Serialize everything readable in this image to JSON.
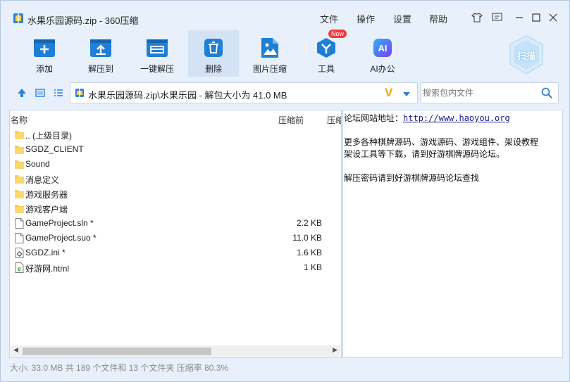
{
  "window": {
    "title": "水果乐园源码.zip - 360压缩"
  },
  "menu": {
    "file": "文件",
    "operate": "操作",
    "settings": "设置",
    "help": "帮助"
  },
  "toolbar": {
    "add": "添加",
    "extract_to": "解压到",
    "one_click_extract": "一键解压",
    "delete": "删除",
    "image_compress": "图片压缩",
    "tools": "工具",
    "tools_badge": "New",
    "ai_office": "AI办公",
    "scan": "扫描"
  },
  "address": {
    "path": "水果乐园源码.zip\\水果乐园 - 解包大小为 41.0 MB"
  },
  "search": {
    "placeholder": "搜索包内文件"
  },
  "file_list": {
    "columns": {
      "name": "名称",
      "compressed": "压缩前",
      "compressed2": "压缩"
    },
    "rows": [
      {
        "name": ".. (上级目录)",
        "size": "",
        "type": "folder"
      },
      {
        "name": "SGDZ_CLIENT",
        "size": "",
        "type": "folder"
      },
      {
        "name": "Sound",
        "size": "",
        "type": "folder"
      },
      {
        "name": "消息定义",
        "size": "",
        "type": "folder"
      },
      {
        "name": "游戏服务器",
        "size": "",
        "type": "folder"
      },
      {
        "name": "游戏客户端",
        "size": "",
        "type": "folder"
      },
      {
        "name": "GameProject.sln *",
        "size": "2.2 KB",
        "type": "file"
      },
      {
        "name": "GameProject.suo *",
        "size": "11.0 KB",
        "type": "file"
      },
      {
        "name": "SGDZ.ini *",
        "size": "1.6 KB",
        "type": "ini"
      },
      {
        "name": "好游网.html",
        "size": "1 KB",
        "type": "html"
      }
    ]
  },
  "comment": {
    "forum_label": "论坛网站地址：",
    "forum_url": "http://www.haoyou.org",
    "line2": "更多各种棋牌源码、游戏源码、游戏组件、架设教程",
    "line3": "架设工具等下载，请到好游棋牌源码论坛。",
    "line4": "解压密码请到好游棋牌源码论坛查找"
  },
  "status": {
    "text": "大小: 33.0 MB 共 189 个文件和 13 个文件夹 压缩率 80.3%"
  },
  "colors": {
    "accent": "#1e7fd6",
    "folder": "#f7cd5a",
    "window_bg": "#e7f0fb"
  }
}
